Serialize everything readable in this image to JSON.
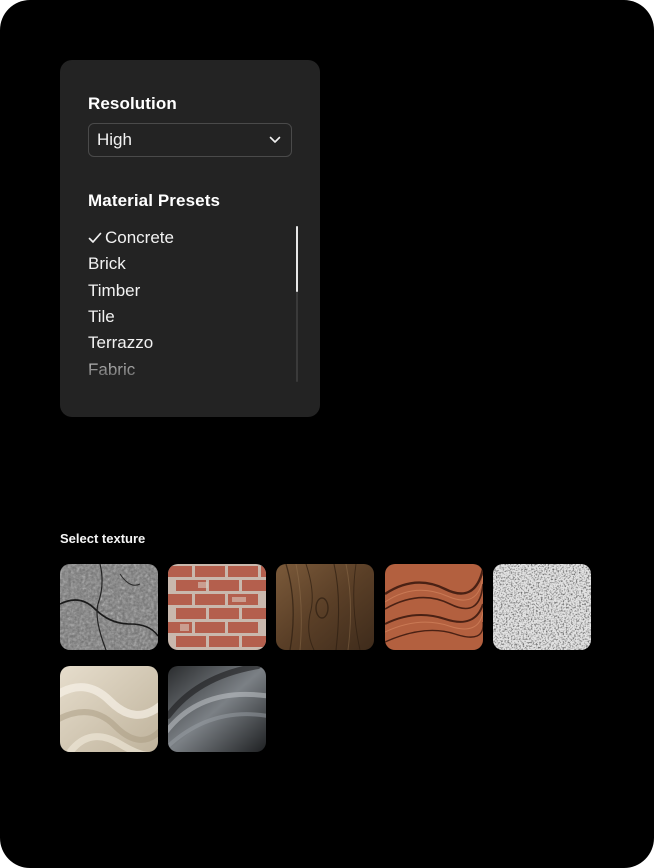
{
  "resolution": {
    "label": "Resolution",
    "selected": "High"
  },
  "materials": {
    "label": "Material Presets",
    "items": [
      "Concrete",
      "Brick",
      "Timber",
      "Tile",
      "Terrazzo",
      "Fabric"
    ],
    "checked_index": 0
  },
  "textures": {
    "label": "Select texture",
    "items": [
      {
        "name": "concrete-texture",
        "color": "#6e6e6e"
      },
      {
        "name": "brick-texture",
        "color": "#b46a58"
      },
      {
        "name": "wood-texture",
        "color": "#6b4a2e"
      },
      {
        "name": "stone-texture",
        "color": "#b3603f"
      },
      {
        "name": "terrazzo-texture",
        "color": "#d9d9d9"
      },
      {
        "name": "fabric-texture",
        "color": "#d8cdb8"
      },
      {
        "name": "metal-texture",
        "color": "#5a5d60"
      }
    ]
  }
}
